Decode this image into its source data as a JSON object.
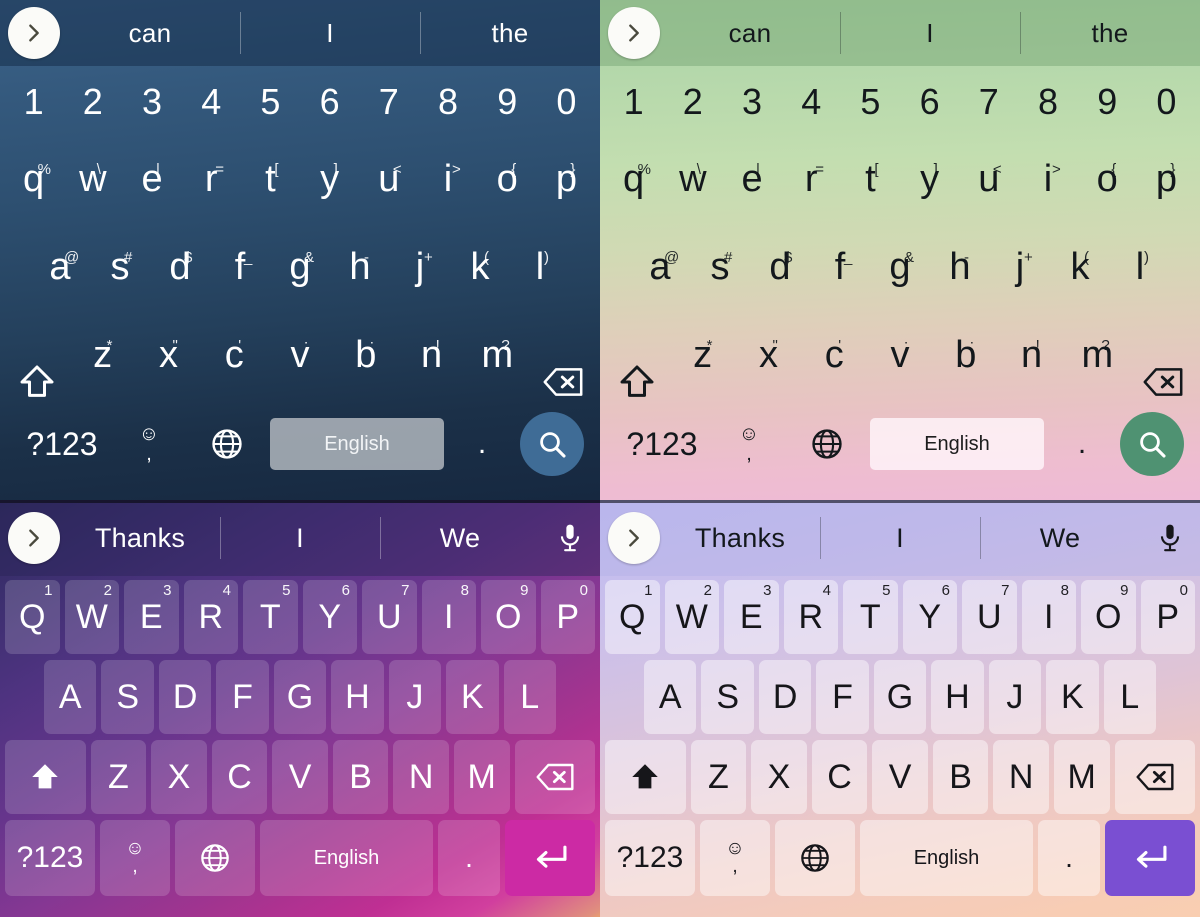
{
  "panels": [
    {
      "id": "blue-theme",
      "theme_name": "dark-blue-gradient",
      "colors": {
        "bg_top": "#3d648b",
        "bg_bottom": "#162840",
        "text": "#ffffff",
        "action_key": "#3f6c96",
        "spacebar": "#bec3c8"
      },
      "layout": "lowercase-flat",
      "suggestions": [
        "can",
        "I",
        "the"
      ],
      "has_mic": false,
      "expand_icon": "chevron-right-icon",
      "rows": {
        "numbers": [
          "1",
          "2",
          "3",
          "4",
          "5",
          "6",
          "7",
          "8",
          "9",
          "0"
        ],
        "top": [
          {
            "main": "q",
            "sub": "%"
          },
          {
            "main": "w",
            "sub": "\\"
          },
          {
            "main": "e",
            "sub": "|"
          },
          {
            "main": "r",
            "sub": "="
          },
          {
            "main": "t",
            "sub": "["
          },
          {
            "main": "y",
            "sub": "]"
          },
          {
            "main": "u",
            "sub": "<"
          },
          {
            "main": "i",
            "sub": ">"
          },
          {
            "main": "o",
            "sub": "{"
          },
          {
            "main": "p",
            "sub": "}"
          }
        ],
        "home": [
          {
            "main": "a",
            "sub": "@"
          },
          {
            "main": "s",
            "sub": "#"
          },
          {
            "main": "d",
            "sub": "$"
          },
          {
            "main": "f",
            "sub": "_"
          },
          {
            "main": "g",
            "sub": "&"
          },
          {
            "main": "h",
            "sub": "-"
          },
          {
            "main": "j",
            "sub": "+"
          },
          {
            "main": "k",
            "sub": "("
          },
          {
            "main": "l",
            "sub": ")"
          }
        ],
        "bottom": [
          {
            "main": "z",
            "sub": "*"
          },
          {
            "main": "x",
            "sub": "\""
          },
          {
            "main": "c",
            "sub": "'"
          },
          {
            "main": "v",
            "sub": ":"
          },
          {
            "main": "b",
            "sub": ";"
          },
          {
            "main": "n",
            "sub": "!"
          },
          {
            "main": "m",
            "sub": "?"
          }
        ]
      },
      "function_row": {
        "symbols_label": "?123",
        "emoji_icon": "smiley-icon",
        "emoji_glyph": "☺",
        "comma_label": ",",
        "globe_icon": "globe-icon",
        "space_label": "English",
        "period_label": ".",
        "action_icon": "search-icon"
      },
      "shift_icon": "shift-up-outline-icon",
      "backspace_icon": "backspace-icon"
    },
    {
      "id": "green-theme",
      "theme_name": "green-to-pink-gradient",
      "colors": {
        "bg_top": "#a9d1a4",
        "bg_bottom": "#eebad6",
        "text": "#13181c",
        "action_key": "#4f9272",
        "spacebar": "#fff5fa"
      },
      "layout": "lowercase-flat",
      "suggestions": [
        "can",
        "I",
        "the"
      ],
      "has_mic": false,
      "expand_icon": "chevron-right-icon",
      "rows": {
        "numbers": [
          "1",
          "2",
          "3",
          "4",
          "5",
          "6",
          "7",
          "8",
          "9",
          "0"
        ],
        "top": [
          {
            "main": "q",
            "sub": "%"
          },
          {
            "main": "w",
            "sub": "\\"
          },
          {
            "main": "e",
            "sub": "|"
          },
          {
            "main": "r",
            "sub": "="
          },
          {
            "main": "t",
            "sub": "["
          },
          {
            "main": "y",
            "sub": "]"
          },
          {
            "main": "u",
            "sub": "<"
          },
          {
            "main": "i",
            "sub": ">"
          },
          {
            "main": "o",
            "sub": "{"
          },
          {
            "main": "p",
            "sub": "}"
          }
        ],
        "home": [
          {
            "main": "a",
            "sub": "@"
          },
          {
            "main": "s",
            "sub": "#"
          },
          {
            "main": "d",
            "sub": "$"
          },
          {
            "main": "f",
            "sub": "_"
          },
          {
            "main": "g",
            "sub": "&"
          },
          {
            "main": "h",
            "sub": "-"
          },
          {
            "main": "j",
            "sub": "+"
          },
          {
            "main": "k",
            "sub": "("
          },
          {
            "main": "l",
            "sub": ")"
          }
        ],
        "bottom": [
          {
            "main": "z",
            "sub": "*"
          },
          {
            "main": "x",
            "sub": "\""
          },
          {
            "main": "c",
            "sub": "'"
          },
          {
            "main": "v",
            "sub": ":"
          },
          {
            "main": "b",
            "sub": ";"
          },
          {
            "main": "n",
            "sub": "!"
          },
          {
            "main": "m",
            "sub": "?"
          }
        ]
      },
      "function_row": {
        "symbols_label": "?123",
        "emoji_icon": "smiley-icon",
        "emoji_glyph": "☺",
        "comma_label": ",",
        "globe_icon": "globe-icon",
        "space_label": "English",
        "period_label": ".",
        "action_icon": "search-icon"
      },
      "shift_icon": "shift-up-outline-icon",
      "backspace_icon": "backspace-icon"
    },
    {
      "id": "purple-theme",
      "theme_name": "purple-magenta-gradient",
      "colors": {
        "bg_top": "#2f2a5e",
        "bg_bottom": "#e8a06f",
        "text": "#ffffff",
        "enter_key": "#cc2aa4",
        "keycap": "rgba(255,255,255,0.16)"
      },
      "layout": "uppercase-capped",
      "suggestions": [
        "Thanks",
        "I",
        "We"
      ],
      "has_mic": true,
      "mic_icon": "microphone-icon",
      "expand_icon": "chevron-right-icon",
      "rows": {
        "top": [
          {
            "main": "Q",
            "sub": "1"
          },
          {
            "main": "W",
            "sub": "2"
          },
          {
            "main": "E",
            "sub": "3"
          },
          {
            "main": "R",
            "sub": "4"
          },
          {
            "main": "T",
            "sub": "5"
          },
          {
            "main": "Y",
            "sub": "6"
          },
          {
            "main": "U",
            "sub": "7"
          },
          {
            "main": "I",
            "sub": "8"
          },
          {
            "main": "O",
            "sub": "9"
          },
          {
            "main": "P",
            "sub": "0"
          }
        ],
        "home": [
          {
            "main": "A",
            "sub": ""
          },
          {
            "main": "S",
            "sub": ""
          },
          {
            "main": "D",
            "sub": ""
          },
          {
            "main": "F",
            "sub": ""
          },
          {
            "main": "G",
            "sub": ""
          },
          {
            "main": "H",
            "sub": ""
          },
          {
            "main": "J",
            "sub": ""
          },
          {
            "main": "K",
            "sub": ""
          },
          {
            "main": "L",
            "sub": ""
          }
        ],
        "bottom": [
          {
            "main": "Z",
            "sub": ""
          },
          {
            "main": "X",
            "sub": ""
          },
          {
            "main": "C",
            "sub": ""
          },
          {
            "main": "V",
            "sub": ""
          },
          {
            "main": "B",
            "sub": ""
          },
          {
            "main": "N",
            "sub": ""
          },
          {
            "main": "M",
            "sub": ""
          }
        ]
      },
      "function_row": {
        "symbols_label": "?123",
        "emoji_icon": "smiley-icon",
        "emoji_glyph": "☺",
        "comma_label": ",",
        "globe_icon": "globe-icon",
        "space_label": "English",
        "period_label": ".",
        "action_icon": "enter-icon"
      },
      "shift_icon": "shift-up-filled-icon",
      "backspace_icon": "backspace-icon"
    },
    {
      "id": "lilac-theme",
      "theme_name": "lavender-to-peach-gradient",
      "colors": {
        "bg_top": "#bfbbef",
        "bg_bottom": "#f9ceb1",
        "text": "#16161a",
        "enter_key": "#7a4fd2",
        "keycap": "rgba(255,255,255,0.45)"
      },
      "layout": "uppercase-capped",
      "suggestions": [
        "Thanks",
        "I",
        "We"
      ],
      "has_mic": true,
      "mic_icon": "microphone-icon",
      "expand_icon": "chevron-right-icon",
      "rows": {
        "top": [
          {
            "main": "Q",
            "sub": "1"
          },
          {
            "main": "W",
            "sub": "2"
          },
          {
            "main": "E",
            "sub": "3"
          },
          {
            "main": "R",
            "sub": "4"
          },
          {
            "main": "T",
            "sub": "5"
          },
          {
            "main": "Y",
            "sub": "6"
          },
          {
            "main": "U",
            "sub": "7"
          },
          {
            "main": "I",
            "sub": "8"
          },
          {
            "main": "O",
            "sub": "9"
          },
          {
            "main": "P",
            "sub": "0"
          }
        ],
        "home": [
          {
            "main": "A",
            "sub": ""
          },
          {
            "main": "S",
            "sub": ""
          },
          {
            "main": "D",
            "sub": ""
          },
          {
            "main": "F",
            "sub": ""
          },
          {
            "main": "G",
            "sub": ""
          },
          {
            "main": "H",
            "sub": ""
          },
          {
            "main": "J",
            "sub": ""
          },
          {
            "main": "K",
            "sub": ""
          },
          {
            "main": "L",
            "sub": ""
          }
        ],
        "bottom": [
          {
            "main": "Z",
            "sub": ""
          },
          {
            "main": "X",
            "sub": ""
          },
          {
            "main": "C",
            "sub": ""
          },
          {
            "main": "V",
            "sub": ""
          },
          {
            "main": "B",
            "sub": ""
          },
          {
            "main": "N",
            "sub": ""
          },
          {
            "main": "M",
            "sub": ""
          }
        ]
      },
      "function_row": {
        "symbols_label": "?123",
        "emoji_icon": "smiley-icon",
        "emoji_glyph": "☺",
        "comma_label": ",",
        "globe_icon": "globe-icon",
        "space_label": "English",
        "period_label": ".",
        "action_icon": "enter-icon"
      },
      "shift_icon": "shift-up-filled-icon",
      "backspace_icon": "backspace-icon"
    }
  ]
}
